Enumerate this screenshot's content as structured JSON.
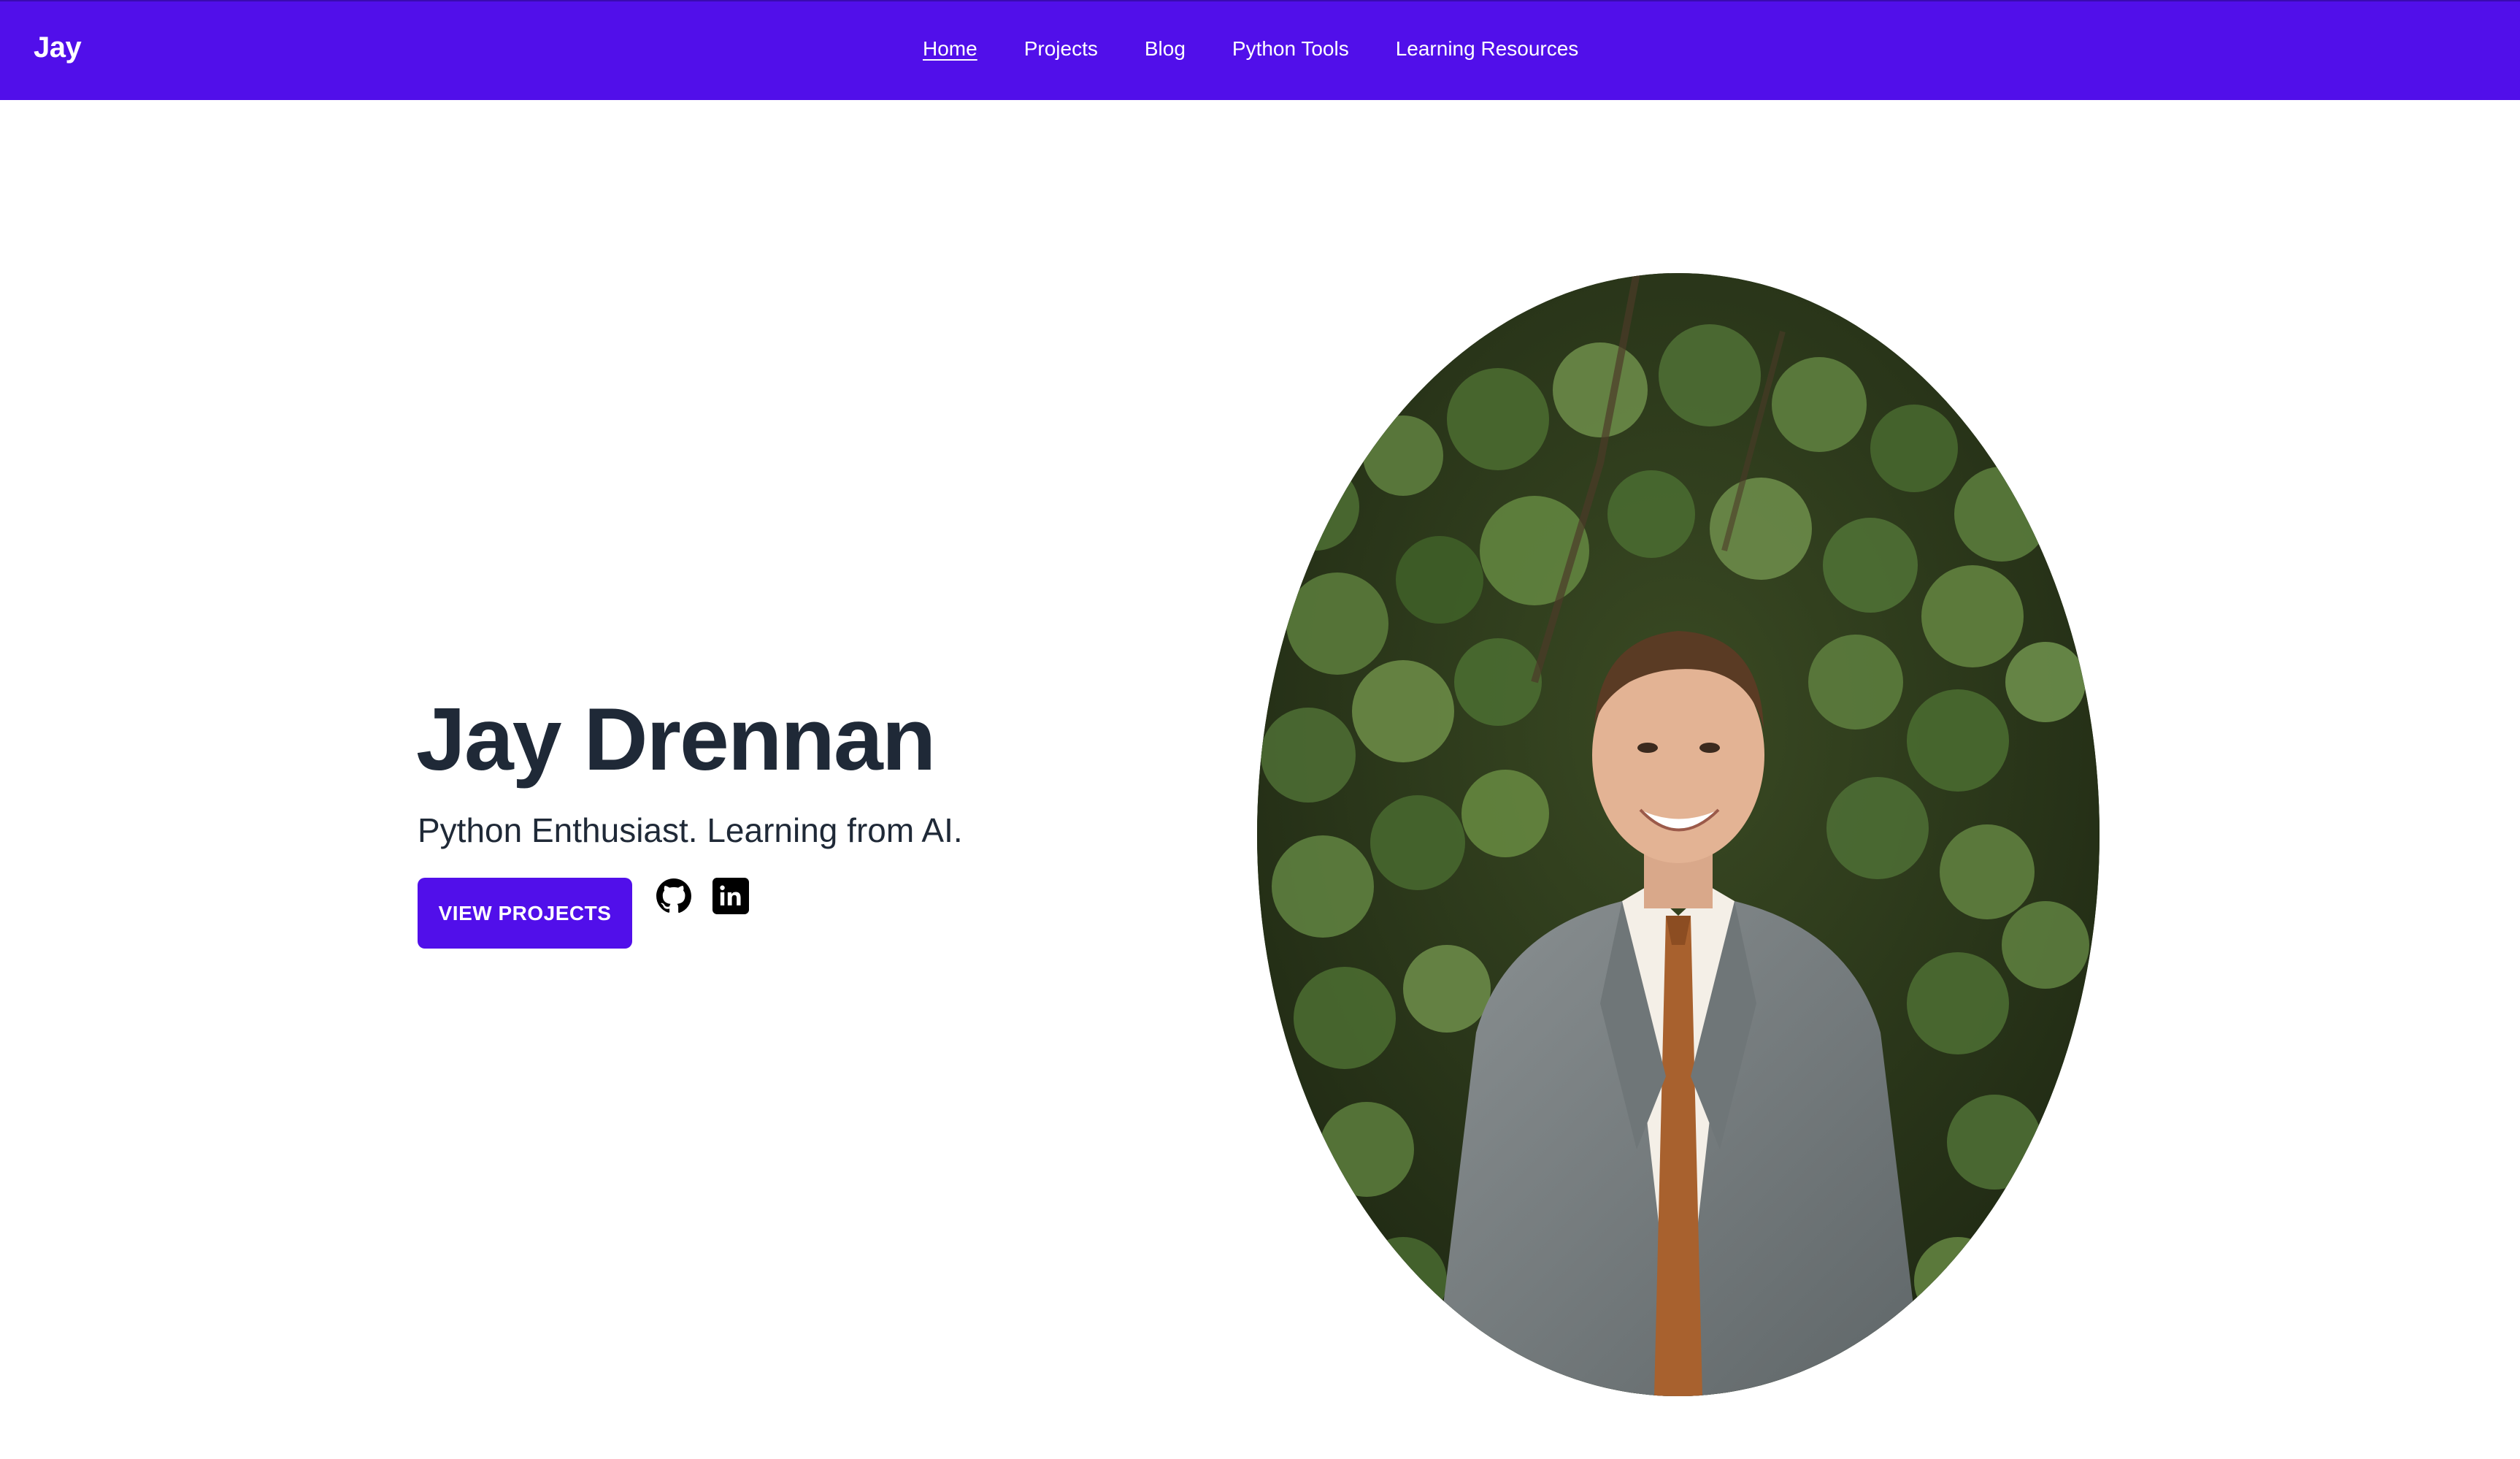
{
  "nav": {
    "brand": "Jay",
    "links": [
      {
        "label": "Home",
        "active": true
      },
      {
        "label": "Projects",
        "active": false
      },
      {
        "label": "Blog",
        "active": false
      },
      {
        "label": "Python Tools",
        "active": false
      },
      {
        "label": "Learning Resources",
        "active": false
      }
    ]
  },
  "hero": {
    "title": "Jay Drennan",
    "subtitle": "Python Enthusiast. Learning from AI.",
    "cta_label": "VIEW PROJECTS",
    "social": [
      {
        "name": "github",
        "icon": "github-icon"
      },
      {
        "name": "linkedin",
        "icon": "linkedin-icon"
      }
    ],
    "portrait_alt": "Portrait photo of Jay Drennan in a grey suit in front of green foliage"
  },
  "colors": {
    "primary": "#510fea",
    "text_dark": "#1f2937",
    "background": "#ffffff"
  }
}
